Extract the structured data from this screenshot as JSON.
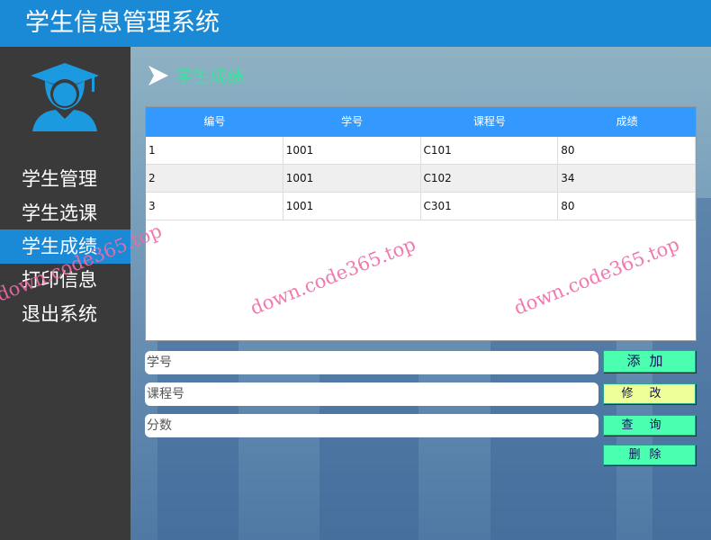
{
  "app": {
    "title": "学生信息管理系统"
  },
  "sidebar": {
    "items": [
      {
        "label": "学生管理"
      },
      {
        "label": "学生选课"
      },
      {
        "label": "学生成绩"
      },
      {
        "label": "打印信息"
      },
      {
        "label": "退出系统"
      }
    ],
    "selected": "学生成绩"
  },
  "main": {
    "section_title": "学生成绩",
    "table": {
      "columns": [
        "编号",
        "学号",
        "课程号",
        "成绩"
      ],
      "rows": [
        [
          "1",
          "1001",
          "C101",
          "80"
        ],
        [
          "2",
          "1001",
          "C102",
          "34"
        ],
        [
          "3",
          "1001",
          "C301",
          "80"
        ]
      ]
    },
    "form": {
      "student_id_placeholder": "学号",
      "course_id_placeholder": "课程号",
      "score_placeholder": "分数"
    },
    "buttons": {
      "add": "添加",
      "edit": "修改",
      "query": "查询",
      "delete": "删除"
    }
  },
  "watermark": "down.code365.top",
  "colors": {
    "header": "#1b8ad6",
    "sidebar": "#3a3a3a",
    "table_header": "#3399ff",
    "button": "#4affb0",
    "edit_button": "#eeff99"
  }
}
